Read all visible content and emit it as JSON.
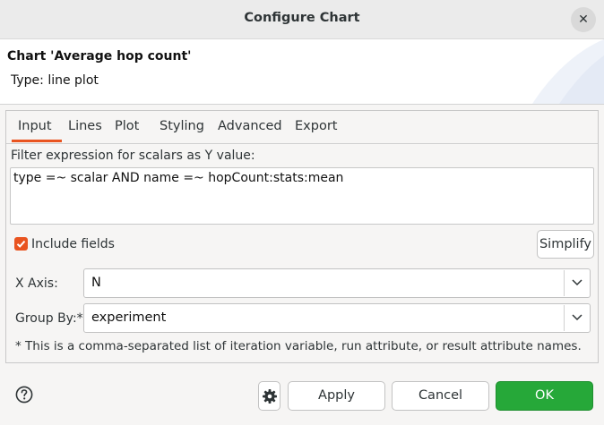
{
  "window": {
    "title": "Configure Chart",
    "close_icon": "close-icon",
    "close_glyph": "✕"
  },
  "banner": {
    "title": "Chart 'Average hop count'",
    "subtitle": "Type: line plot"
  },
  "tabs": [
    {
      "label": "Input",
      "selected": true
    },
    {
      "label": "Lines",
      "selected": false
    },
    {
      "label": "Plot",
      "selected": false
    },
    {
      "label": "Styling",
      "selected": false
    },
    {
      "label": "Advanced",
      "selected": false
    },
    {
      "label": "Export",
      "selected": false
    }
  ],
  "input": {
    "filter_label": "Filter expression for scalars as Y value:",
    "filter_value": "type =~ scalar AND name =~ hopCount:stats:mean",
    "include_fields_label": "Include fields",
    "include_fields_checked": true,
    "simplify_label": "Simplify",
    "x_axis_label": "X Axis:",
    "x_axis_value": "N",
    "group_by_label": "Group By:*",
    "group_by_value": "experiment",
    "footnote": "* This is a comma-separated list of iteration variable, run attribute, or result attribute names."
  },
  "footer": {
    "help_icon": "help-icon",
    "settings_icon": "gear-icon",
    "apply_label": "Apply",
    "cancel_label": "Cancel",
    "ok_label": "OK"
  },
  "colors": {
    "accent": "#e95420",
    "ok_button": "#26a839"
  }
}
